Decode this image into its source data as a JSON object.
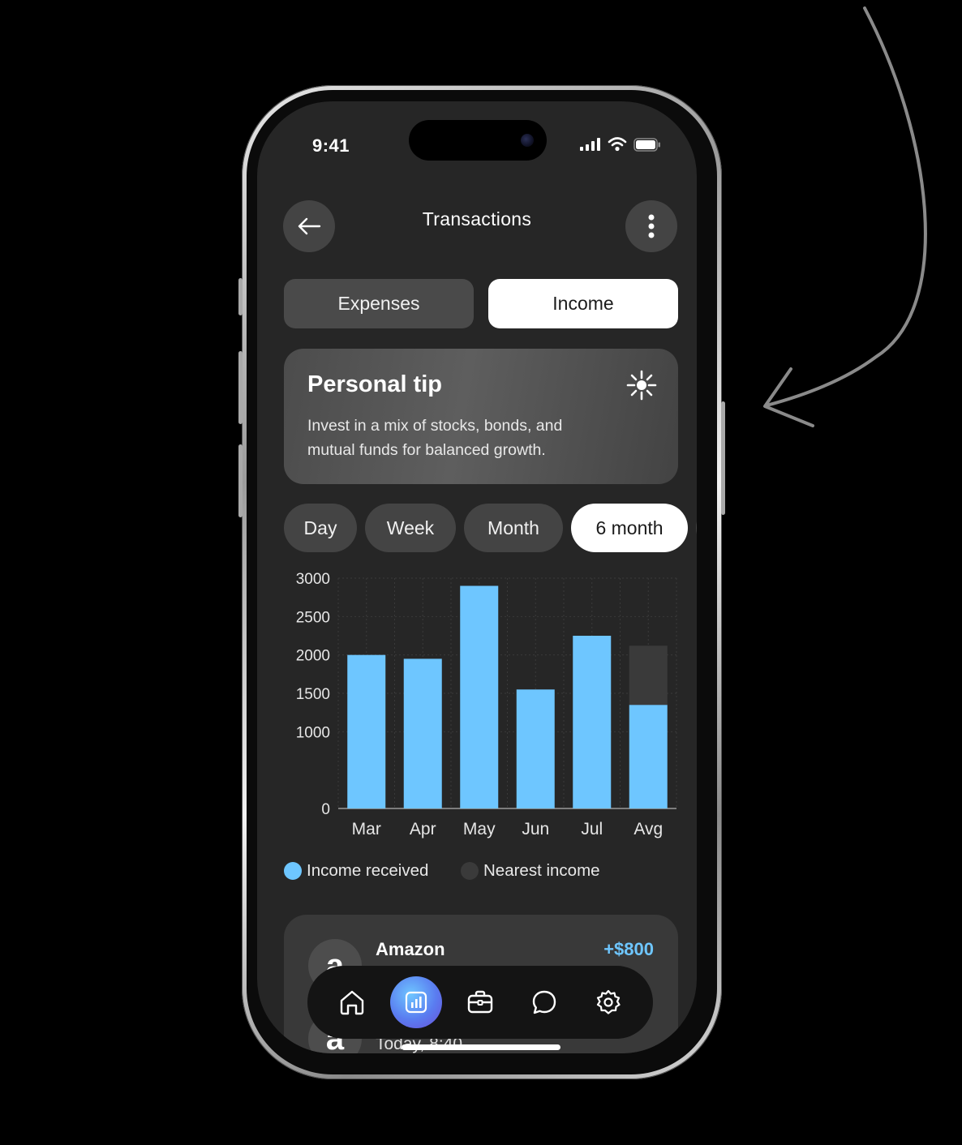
{
  "status": {
    "time": "9:41"
  },
  "header": {
    "title": "Transactions"
  },
  "tabs": [
    {
      "label": "Expenses",
      "active": false
    },
    {
      "label": "Income",
      "active": true
    }
  ],
  "tip": {
    "title": "Personal tip",
    "line1": "Invest in a mix of stocks, bonds, and",
    "line2": "mutual funds for balanced growth.",
    "icon": "sparkle-icon"
  },
  "periods": [
    {
      "label": "Day",
      "active": false
    },
    {
      "label": "Week",
      "active": false
    },
    {
      "label": "Month",
      "active": false
    },
    {
      "label": "6 month",
      "active": true
    }
  ],
  "chart_data": {
    "type": "bar",
    "categories": [
      "Mar",
      "Apr",
      "May",
      "Jun",
      "Jul",
      "Avg"
    ],
    "series": [
      {
        "name": "Income received",
        "values": [
          2000,
          1950,
          2900,
          1550,
          2250,
          1350
        ],
        "color": "#6ec6ff"
      },
      {
        "name": "Nearest income",
        "values": [
          0,
          0,
          0,
          0,
          0,
          770
        ],
        "color": "#3a3a3a"
      }
    ],
    "stacked": true,
    "yticks": [
      0,
      1000,
      1500,
      2000,
      2500,
      3000
    ],
    "ylim": [
      0,
      3000
    ],
    "grid": true,
    "legend": "bottom"
  },
  "legend": [
    {
      "label": "Income received",
      "color": "#6ec6ff"
    },
    {
      "label": "Nearest income",
      "color": "#3a3a3a"
    }
  ],
  "transaction": {
    "avatar": "a",
    "name": "Amazon",
    "amount": "+$800",
    "time": "Today, 8:40"
  },
  "nav": [
    {
      "icon": "home-icon",
      "active": false
    },
    {
      "icon": "chart-icon",
      "active": true
    },
    {
      "icon": "briefcase-icon",
      "active": false
    },
    {
      "icon": "chat-icon",
      "active": false
    },
    {
      "icon": "settings-icon",
      "active": false
    }
  ],
  "colors": {
    "accent": "#6ec6ff",
    "screen": "#262626",
    "card": "#393939"
  }
}
